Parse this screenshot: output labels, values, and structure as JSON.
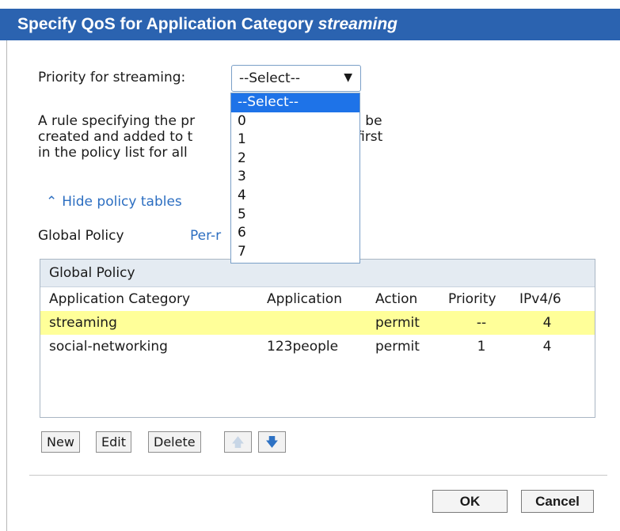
{
  "dialog": {
    "title_prefix": "Specify QoS for Application Category ",
    "title_category": "streaming"
  },
  "priority": {
    "label": "Priority for streaming:",
    "selected": "--Select--",
    "options": [
      "--Select--",
      "0",
      "1",
      "2",
      "3",
      "4",
      "5",
      "6",
      "7"
    ]
  },
  "description": {
    "line1": "A rule specifying the pr",
    "line1b": "ning traffic will be",
    "line2": "created and added to t",
    "line2b": ", which comes first",
    "line3": "in the policy list for all"
  },
  "toggle_link": "Hide policy tables",
  "tabs": {
    "global": "Global Policy",
    "per": "Per-r"
  },
  "table": {
    "title": "Global Policy",
    "headers": [
      "Application Category",
      "Application",
      "Action",
      "Priority",
      "IPv4/6"
    ],
    "rows": [
      {
        "category": "streaming",
        "application": "",
        "action": "permit",
        "priority": "--",
        "ip": "4"
      },
      {
        "category": "social-networking",
        "application": "123people",
        "action": "permit",
        "priority": "1",
        "ip": "4"
      }
    ]
  },
  "buttons": {
    "new": "New",
    "edit": "Edit",
    "delete": "Delete",
    "ok": "OK",
    "cancel": "Cancel"
  },
  "colors": {
    "title_bar": "#2b63b0",
    "highlight_row": "#ffff99",
    "link": "#2c6ec1",
    "selected_option": "#1e73e8"
  }
}
